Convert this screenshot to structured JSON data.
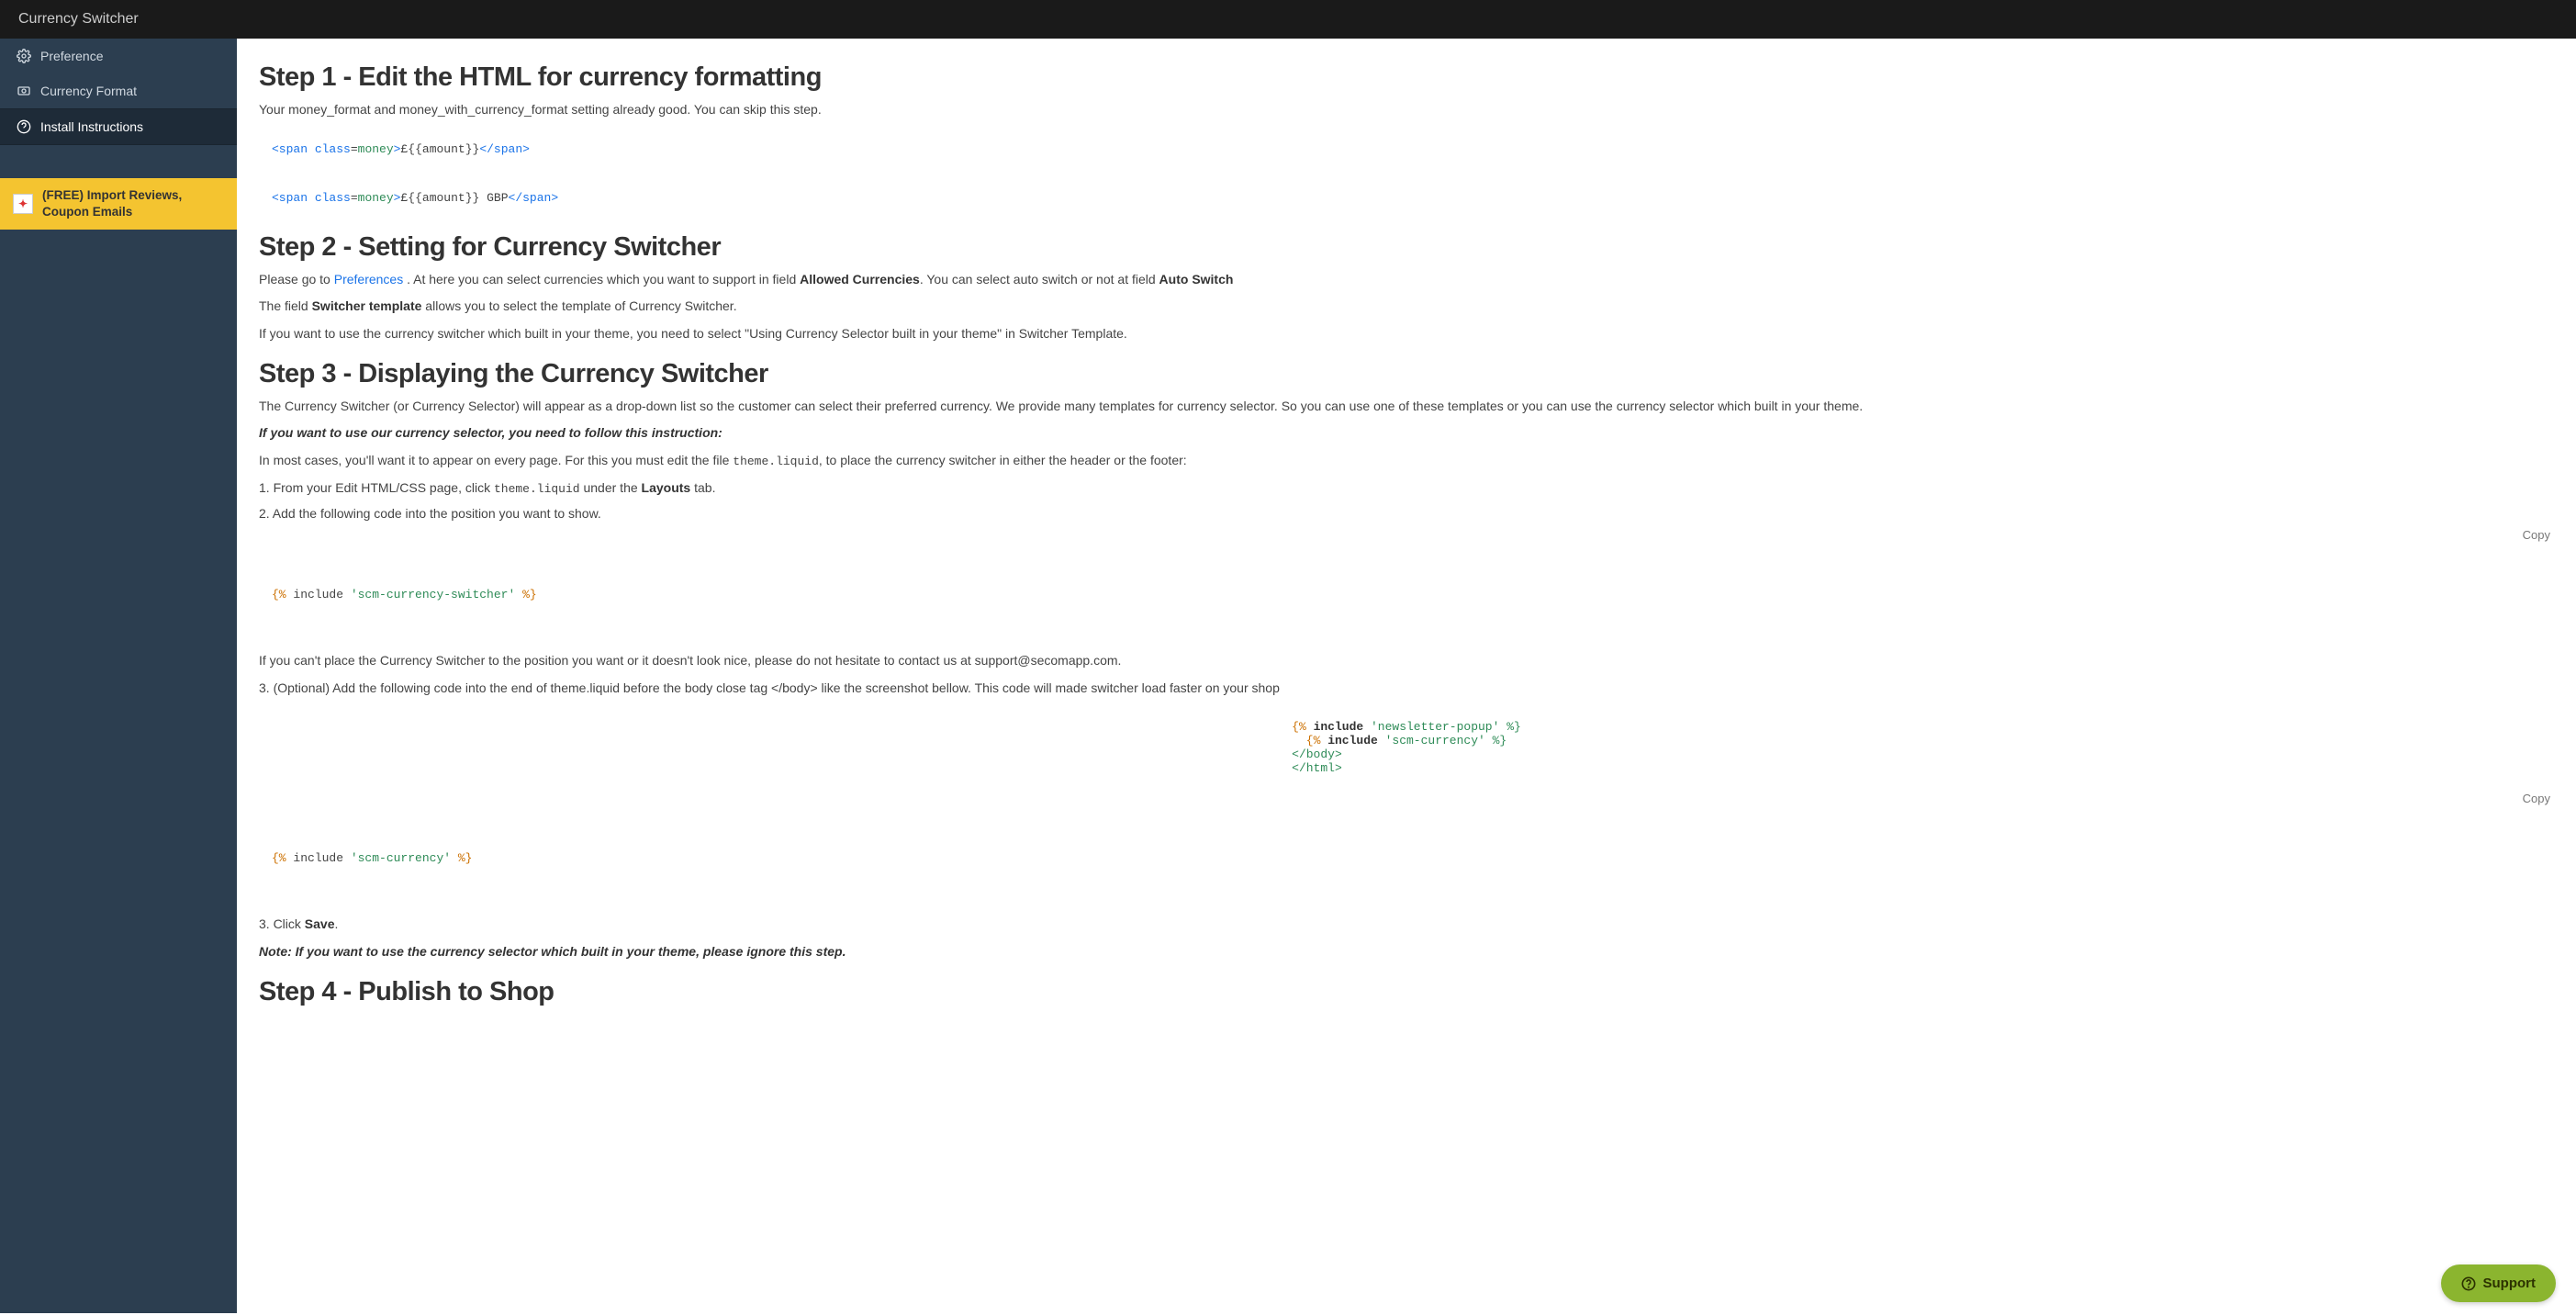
{
  "app_title": "Currency Switcher",
  "sidebar": {
    "items": [
      {
        "label": "Preference",
        "icon": "gear-icon"
      },
      {
        "label": "Currency Format",
        "icon": "currency-format-icon"
      },
      {
        "label": "Install Instructions",
        "icon": "question-circle-icon"
      }
    ],
    "promo_label": "(FREE) Import Reviews, Coupon Emails"
  },
  "step1": {
    "heading": "Step 1 - Edit the HTML for currency formatting",
    "intro": "Your money_format and money_with_currency_format setting already good. You can skip this step.",
    "code1": "<span class=money>£{{amount}}</span>",
    "code2": "<span class=money>£{{amount}} GBP</span>"
  },
  "step2": {
    "heading": "Step 2 - Setting for Currency Switcher",
    "p1_pre": "Please go to ",
    "p1_link": "Preferences",
    "p1_mid": " . At here you can select currencies which you want to support in field ",
    "p1_bold1": "Allowed Currencies",
    "p1_mid2": ". You can select auto switch or not at field ",
    "p1_bold2": "Auto Switch",
    "p2_pre": "The field ",
    "p2_bold": "Switcher template",
    "p2_post": " allows you to select the template of Currency Switcher.",
    "p3": "If you want to use the currency switcher which built in your theme, you need to select \"Using Currency Selector built in your theme\" in Switcher Template."
  },
  "step3": {
    "heading": "Step 3 - Displaying the Currency Switcher",
    "p1": "The Currency Switcher (or Currency Selector) will appear as a drop-down list so the customer can select their preferred currency. We provide many templates for currency selector. So you can use one of these templates or you can use the currency selector which built in your theme.",
    "p2_ital": "If you want to use our currency selector, you need to follow this instruction:",
    "p2b_pre": "In most cases, you'll want it to appear on every page. For this you must edit the file ",
    "p2b_code": "theme.liquid",
    "p2b_post": ", to place the currency switcher in either the header or the footer:",
    "ol1_pre": "1. From your Edit HTML/CSS page, click ",
    "ol1_code": "theme.liquid",
    "ol1_mid": " under the ",
    "ol1_bold": "Layouts",
    "ol1_post": " tab.",
    "ol2": "2. Add the following code into the position you want to show.",
    "code1": "{% include 'scm-currency-switcher' %}",
    "copy": "Copy",
    "p4": "If you can't place the Currency Switcher to the position you want or it doesn't look nice, please do not hesitate to contact us at support@secomapp.com.",
    "ol3": "3. (Optional) Add the following code into the end of theme.liquid before the body close tag </body> like the screenshot bellow. This code will made switcher load faster on your shop",
    "code2_l1a": "{% ",
    "code2_l1b": "include",
    "code2_l1c": " 'newsletter-popup' %}",
    "code2_l2a": "{% ",
    "code2_l2b": "include",
    "code2_l2c": " 'scm-currency' %}",
    "code2_l3": "</body>",
    "code2_l4": "</html>",
    "code3": "{% include 'scm-currency' %}",
    "ol4_pre": "3. Click ",
    "ol4_bold": "Save",
    "ol4_post": ".",
    "note": "Note: If you want to use the currency selector which built in your theme, please ignore this step."
  },
  "step4": {
    "heading": "Step 4 - Publish to Shop"
  },
  "support_label": "Support"
}
